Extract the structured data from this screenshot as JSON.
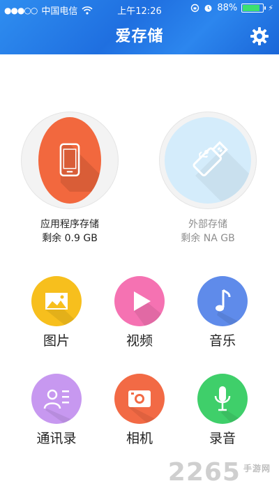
{
  "status": {
    "carrier": "中国电信",
    "time": "上午12:26",
    "battery": "88%",
    "battery_level": 0.88
  },
  "header": {
    "title": "爱存储"
  },
  "storage": {
    "internal": {
      "label": "应用程序存储",
      "remaining": "剩余 0.9 GB"
    },
    "external": {
      "label": "外部存储",
      "remaining": "剩余 NA GB"
    }
  },
  "apps": [
    {
      "label": "图片",
      "color": "#f7bf1d"
    },
    {
      "label": "视频",
      "color": "#f572b2"
    },
    {
      "label": "音乐",
      "color": "#5f8bea"
    },
    {
      "label": "通讯录",
      "color": "#c798f0"
    },
    {
      "label": "相机",
      "color": "#f26a45"
    },
    {
      "label": "录音",
      "color": "#3fcf6a"
    }
  ],
  "watermark": {
    "brand": "2265",
    "site": "手游网"
  }
}
